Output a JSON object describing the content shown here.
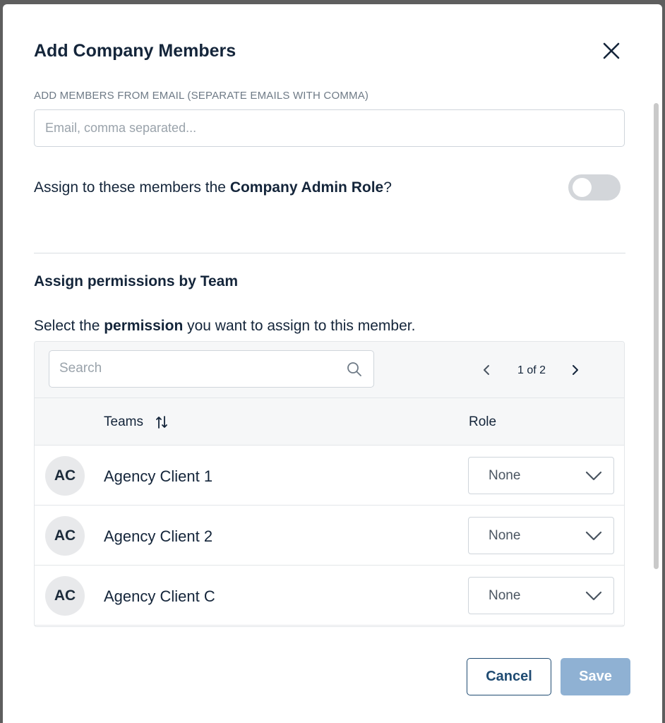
{
  "modal": {
    "title": "Add Company Members",
    "email": {
      "label": "ADD MEMBERS FROM EMAIL (SEPARATE EMAILS WITH COMMA)",
      "placeholder": "Email, comma separated...",
      "value": ""
    },
    "admin_role": {
      "prefix": "Assign to these members the ",
      "role_name": "Company Admin Role",
      "suffix": "?",
      "enabled": false
    },
    "team_section": {
      "title": "Assign permissions by Team",
      "desc_prefix": "Select the ",
      "desc_bold": "permission",
      "desc_suffix": " you want to assign to this member.",
      "search_placeholder": "Search",
      "pager": "1 of 2",
      "columns": {
        "teams": "Teams",
        "role": "Role"
      },
      "rows": [
        {
          "initials": "AC",
          "name": "Agency Client 1",
          "role": "None"
        },
        {
          "initials": "AC",
          "name": "Agency Client 2",
          "role": "None"
        },
        {
          "initials": "AC",
          "name": "Agency Client C",
          "role": "None"
        }
      ]
    },
    "buttons": {
      "cancel": "Cancel",
      "save": "Save"
    }
  },
  "colors": {
    "primary": "#1f4b72",
    "save_disabled": "#8fb1d3",
    "text": "#14253a",
    "toggle_off": "#d3d6da"
  }
}
